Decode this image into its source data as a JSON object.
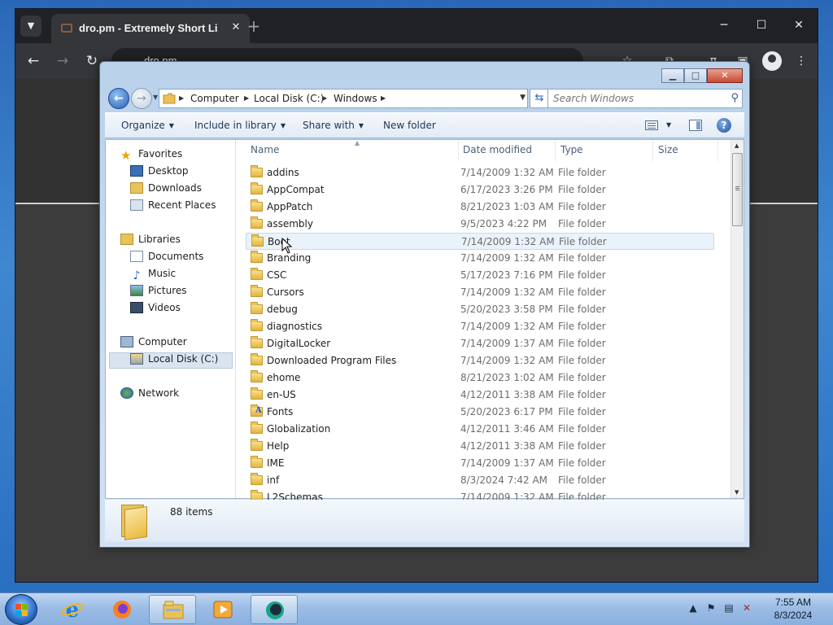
{
  "browser": {
    "tab_title": "dro.pm - Extremely Short Link",
    "tab_close": "✕",
    "new_tab": "+",
    "url": "dro.pm"
  },
  "explorer": {
    "caption": {
      "minimize": "▁",
      "maximize": "□",
      "close": "✕"
    },
    "breadcrumb": [
      "Computer",
      "Local Disk (C:)",
      "Windows"
    ],
    "search_placeholder": "Search Windows",
    "commands": {
      "organize": "Organize",
      "include_in_library": "Include in library",
      "share_with": "Share with",
      "new_folder": "New folder"
    },
    "nav": {
      "favorites": "Favorites",
      "desktop": "Desktop",
      "downloads": "Downloads",
      "recent_places": "Recent Places",
      "libraries": "Libraries",
      "documents": "Documents",
      "music": "Music",
      "pictures": "Pictures",
      "videos": "Videos",
      "computer": "Computer",
      "local_disk": "Local Disk (C:)",
      "network": "Network"
    },
    "columns": {
      "name": "Name",
      "date_modified": "Date modified",
      "type": "Type",
      "size": "Size"
    },
    "files": [
      {
        "name": "addins",
        "date": "7/14/2009 1:32 AM",
        "type": "File folder"
      },
      {
        "name": "AppCompat",
        "date": "6/17/2023 3:26 PM",
        "type": "File folder"
      },
      {
        "name": "AppPatch",
        "date": "8/21/2023 1:03 AM",
        "type": "File folder"
      },
      {
        "name": "assembly",
        "date": "9/5/2023 4:22 PM",
        "type": "File folder"
      },
      {
        "name": "Boot",
        "date": "7/14/2009 1:32 AM",
        "type": "File folder"
      },
      {
        "name": "Branding",
        "date": "7/14/2009 1:32 AM",
        "type": "File folder"
      },
      {
        "name": "CSC",
        "date": "5/17/2023 7:16 PM",
        "type": "File folder"
      },
      {
        "name": "Cursors",
        "date": "7/14/2009 1:32 AM",
        "type": "File folder"
      },
      {
        "name": "debug",
        "date": "5/20/2023 3:58 PM",
        "type": "File folder"
      },
      {
        "name": "diagnostics",
        "date": "7/14/2009 1:32 AM",
        "type": "File folder"
      },
      {
        "name": "DigitalLocker",
        "date": "7/14/2009 1:37 AM",
        "type": "File folder"
      },
      {
        "name": "Downloaded Program Files",
        "date": "7/14/2009 1:32 AM",
        "type": "File folder"
      },
      {
        "name": "ehome",
        "date": "8/21/2023 1:02 AM",
        "type": "File folder"
      },
      {
        "name": "en-US",
        "date": "4/12/2011 3:38 AM",
        "type": "File folder"
      },
      {
        "name": "Fonts",
        "date": "5/20/2023 6:17 PM",
        "type": "File folder"
      },
      {
        "name": "Globalization",
        "date": "4/12/2011 3:46 AM",
        "type": "File folder"
      },
      {
        "name": "Help",
        "date": "4/12/2011 3:38 AM",
        "type": "File folder"
      },
      {
        "name": "IME",
        "date": "7/14/2009 1:37 AM",
        "type": "File folder"
      },
      {
        "name": "inf",
        "date": "8/3/2024 7:42 AM",
        "type": "File folder"
      },
      {
        "name": "L2Schemas",
        "date": "7/14/2009 1:32 AM",
        "type": "File folder"
      }
    ],
    "item_count": "88 items"
  },
  "taskbar": {
    "time": "7:55 AM",
    "date": "8/3/2024"
  }
}
